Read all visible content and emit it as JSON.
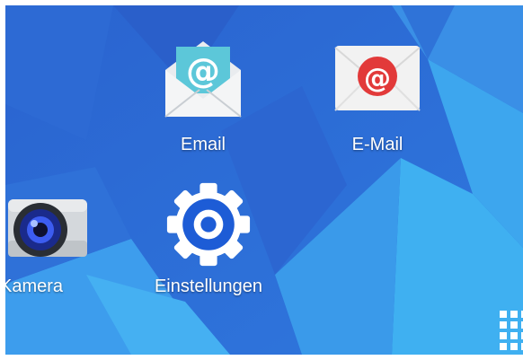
{
  "home_screen": {
    "apps": {
      "email": {
        "label": "Email",
        "icon": "email-envelope-icon"
      },
      "email2": {
        "label": "E-Mail",
        "icon": "email-red-envelope-icon"
      },
      "kamera": {
        "label": "Kamera",
        "icon": "camera-icon"
      },
      "settings": {
        "label": "Einstellungen",
        "icon": "gear-icon"
      }
    },
    "apps_button": {
      "icon": "app-grid-icon"
    }
  },
  "colors": {
    "wallpaper_base": "#2f6fd6",
    "wallpaper_light": "#3aa2ee",
    "settings_blue": "#1d5cd6",
    "email_red": "#e23a3a",
    "email_teal": "#5cc7d9"
  }
}
